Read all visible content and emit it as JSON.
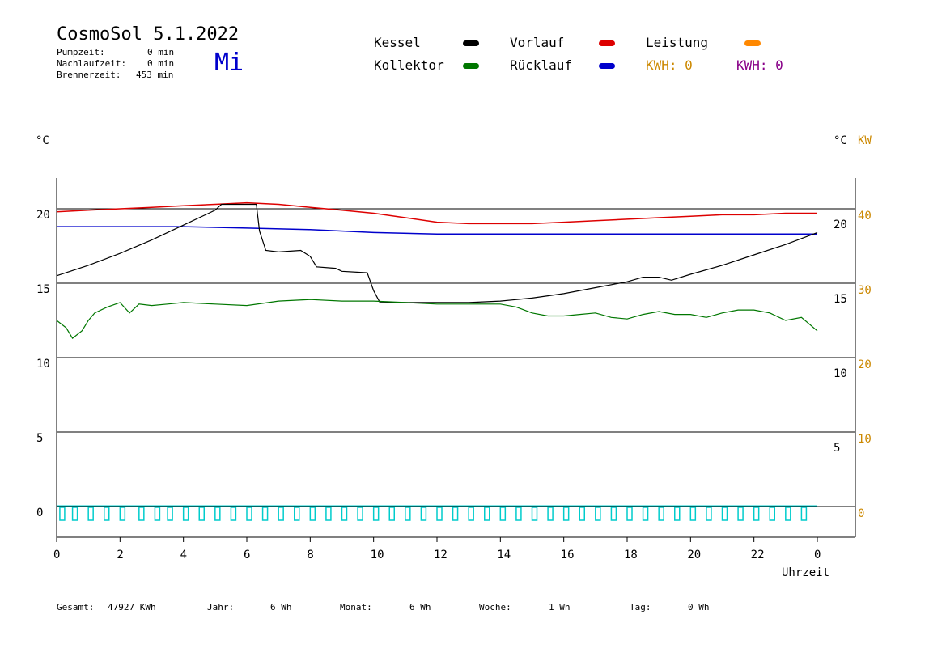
{
  "header": {
    "title": "CosmoSol 5.1.2022",
    "day": "Mi",
    "stats": [
      {
        "label": "Pumpzeit:",
        "value": "0 min"
      },
      {
        "label": "Nachlaufzeit:",
        "value": "0 min"
      },
      {
        "label": "Brennerzeit:",
        "value": "453 min"
      }
    ]
  },
  "legend": {
    "kessel": "Kessel",
    "kollektor": "Kollektor",
    "vorlauf": "Vorlauf",
    "ruecklauf": "Rücklauf",
    "leistung": "Leistung",
    "kwh_orange": "KWH: 0",
    "kwh_purple": "KWH: 0"
  },
  "axes": {
    "left_unit": "°C",
    "right_unit": "°C",
    "right_unit2": "KW",
    "xlabel": "Uhrzeit"
  },
  "footer": [
    {
      "label": "Gesamt:",
      "value": "47927 KWh"
    },
    {
      "label": "Jahr:",
      "value": "6 Wh"
    },
    {
      "label": "Monat:",
      "value": "6 Wh"
    },
    {
      "label": "Woche:",
      "value": "1 Wh"
    },
    {
      "label": "Tag:",
      "value": "0 Wh"
    }
  ],
  "colors": {
    "kessel": "#000000",
    "kollektor": "#007700",
    "vorlauf": "#dd0000",
    "ruecklauf": "#0000cc",
    "leistung": "#ff8800",
    "kwh_purple": "#880088",
    "pump": "#00cccc",
    "right_axis2": "#cc8800"
  },
  "chart_data": {
    "type": "line",
    "x_range": [
      0,
      24
    ],
    "x_ticks": [
      "0",
      "2",
      "4",
      "6",
      "8",
      "10",
      "12",
      "14",
      "16",
      "18",
      "20",
      "22",
      "0"
    ],
    "y_left_ticks": [
      "0",
      "5",
      "10",
      "15",
      "20"
    ],
    "y_left_range": [
      -1.5,
      22.5
    ],
    "y_right1_ticks": [
      "5",
      "10",
      "15",
      "20"
    ],
    "y_right2_ticks": [
      "0",
      "10",
      "20",
      "30",
      "40"
    ],
    "grid_lines_y": [
      0,
      5,
      10,
      15,
      20
    ],
    "series": [
      {
        "name": "Vorlauf",
        "key": "vorlauf",
        "x": [
          0,
          1,
          2,
          3,
          4,
          5,
          6,
          7,
          8,
          9,
          10,
          11,
          12,
          13,
          14,
          15,
          16,
          17,
          18,
          19,
          20,
          21,
          22,
          23,
          24
        ],
        "y": [
          19.8,
          19.9,
          20.0,
          20.1,
          20.2,
          20.3,
          20.4,
          20.3,
          20.1,
          19.9,
          19.7,
          19.4,
          19.1,
          19.0,
          19.0,
          19.0,
          19.1,
          19.2,
          19.3,
          19.4,
          19.5,
          19.6,
          19.6,
          19.7,
          19.7
        ]
      },
      {
        "name": "Rücklauf",
        "key": "ruecklauf",
        "x": [
          0,
          2,
          4,
          6,
          8,
          10,
          12,
          14,
          16,
          18,
          20,
          22,
          24
        ],
        "y": [
          18.8,
          18.8,
          18.8,
          18.7,
          18.6,
          18.4,
          18.3,
          18.3,
          18.3,
          18.3,
          18.3,
          18.3,
          18.3
        ]
      },
      {
        "name": "Kessel",
        "key": "kessel",
        "x": [
          0,
          1,
          2,
          3,
          4,
          5,
          5.2,
          6.3,
          6.4,
          6.6,
          7.0,
          7.7,
          8.0,
          8.2,
          8.8,
          9.0,
          9.8,
          10.0,
          10.2,
          11,
          12,
          13,
          14,
          15,
          16,
          17,
          18,
          18.5,
          19,
          19.4,
          20,
          21,
          22,
          23,
          24
        ],
        "y": [
          15.5,
          16.2,
          17.0,
          17.9,
          18.9,
          19.9,
          20.3,
          20.3,
          18.5,
          17.2,
          17.1,
          17.2,
          16.8,
          16.1,
          16.0,
          15.8,
          15.7,
          14.5,
          13.7,
          13.7,
          13.7,
          13.7,
          13.8,
          14.0,
          14.3,
          14.7,
          15.1,
          15.4,
          15.4,
          15.2,
          15.6,
          16.2,
          16.9,
          17.6,
          18.4
        ]
      },
      {
        "name": "Kollektor",
        "key": "kollektor",
        "x": [
          0,
          0.3,
          0.5,
          0.8,
          1.0,
          1.2,
          1.6,
          2.0,
          2.3,
          2.6,
          3.0,
          3.5,
          4,
          5,
          6,
          7,
          8,
          9,
          10,
          11,
          12,
          13,
          14,
          14.5,
          15,
          15.5,
          16,
          16.5,
          17,
          17.5,
          18,
          18.5,
          19,
          19.5,
          20,
          20.5,
          21,
          21.5,
          22,
          22.5,
          23,
          23.5,
          24
        ],
        "y": [
          12.5,
          12.0,
          11.3,
          11.8,
          12.5,
          13.0,
          13.4,
          13.7,
          13.0,
          13.6,
          13.5,
          13.6,
          13.7,
          13.6,
          13.5,
          13.8,
          13.9,
          13.8,
          13.8,
          13.7,
          13.6,
          13.6,
          13.6,
          13.4,
          13.0,
          12.8,
          12.8,
          12.9,
          13.0,
          12.7,
          12.6,
          12.9,
          13.1,
          12.9,
          12.9,
          12.7,
          13.0,
          13.2,
          13.2,
          13.0,
          12.5,
          12.7,
          11.8
        ]
      },
      {
        "name": "Pumpe",
        "key": "pump",
        "x": [
          0.1,
          0.5,
          1.0,
          1.5,
          2.0,
          2.6,
          3.1,
          3.5,
          4.0,
          4.5,
          5.0,
          5.5,
          6.0,
          6.5,
          7.0,
          7.5,
          8.0,
          8.5,
          9.0,
          9.5,
          10.0,
          10.5,
          11.0,
          11.5,
          12.0,
          12.5,
          13.0,
          13.5,
          14.0,
          14.5,
          15.0,
          15.5,
          16.0,
          16.5,
          17.0,
          17.5,
          18.0,
          18.5,
          19.0,
          19.5,
          20.0,
          20.5,
          21.0,
          21.5,
          22.0,
          22.5,
          23.0,
          23.5
        ],
        "y": [
          0,
          0,
          0,
          0,
          0,
          0,
          0,
          0,
          0,
          0,
          0,
          0,
          0,
          0,
          0,
          0,
          0,
          0,
          0,
          0,
          0,
          0,
          0,
          0,
          0,
          0,
          0,
          0,
          0,
          0,
          0,
          0,
          0,
          0,
          0,
          0,
          0,
          0,
          0,
          0,
          0,
          0,
          0,
          0,
          0,
          0,
          0,
          0
        ]
      }
    ]
  }
}
